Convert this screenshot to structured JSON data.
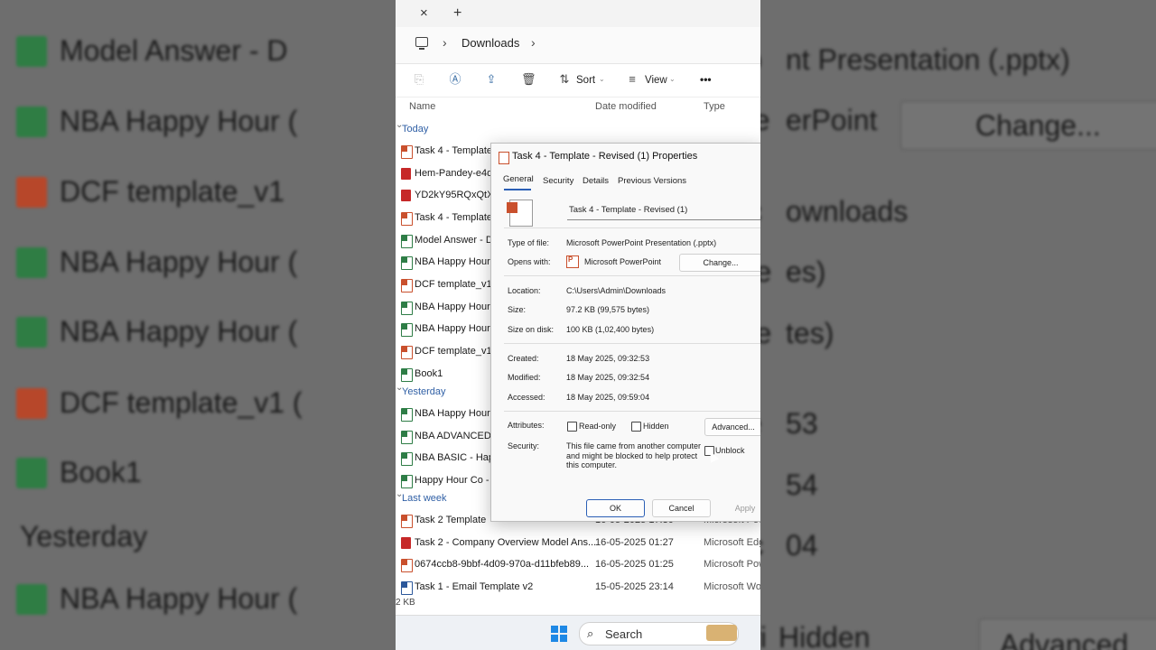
{
  "window": {
    "tab_close": "×",
    "tab_add": "+",
    "breadcrumb": "Downloads",
    "toolbar": {
      "sort_label": "Sort",
      "view_label": "View",
      "more_label": "•••"
    },
    "columns": {
      "name": "Name",
      "date": "Date modified",
      "type": "Type"
    },
    "groups": {
      "today": "Today",
      "yesterday": "Yesterday",
      "last_week": "Last week"
    },
    "files_today": [
      {
        "name": "Task 4 - Template - Revised (1)",
        "icon": "pp"
      },
      {
        "name": "Hem-Pandey-e4de",
        "icon": "pdf"
      },
      {
        "name": "YD2kY95RQxQtXx",
        "icon": "pdf"
      },
      {
        "name": "Task 4 - Template",
        "icon": "pp"
      },
      {
        "name": "Model Answer - D",
        "icon": "xl"
      },
      {
        "name": "NBA Happy Hour",
        "icon": "xl"
      },
      {
        "name": "DCF template_v1",
        "icon": "pp"
      },
      {
        "name": "NBA Happy Hour",
        "icon": "xl"
      },
      {
        "name": "NBA Happy Hour",
        "icon": "xl"
      },
      {
        "name": "DCF template_v1 (",
        "icon": "pp"
      },
      {
        "name": "Book1",
        "icon": "xl"
      }
    ],
    "files_yesterday": [
      {
        "name": "NBA Happy Hour",
        "icon": "xl"
      },
      {
        "name": "NBA ADVANCED -",
        "icon": "xl"
      },
      {
        "name": "NBA BASIC - Happ",
        "icon": "xl"
      },
      {
        "name": "Happy Hour Co - F",
        "icon": "xl"
      }
    ],
    "files_last_week": [
      {
        "name": "Task 2 Template",
        "date": "16-05-2025 17:30",
        "type": "Microsoft Pow",
        "icon": "pp"
      },
      {
        "name": "Task 2 - Company Overview Model Ans...",
        "date": "16-05-2025 01:27",
        "type": "Microsoft Edg",
        "icon": "pdf"
      },
      {
        "name": "0674ccb8-9bbf-4d09-970a-d11bfeb89...",
        "date": "16-05-2025 01:25",
        "type": "Microsoft Pow",
        "icon": "pp"
      },
      {
        "name": "Task 1 - Email Template v2",
        "date": "15-05-2025 23:14",
        "type": "Microsoft Wo",
        "icon": "wd"
      }
    ],
    "status": "2 KB",
    "taskbar": {
      "search_label": "Search"
    }
  },
  "dialog": {
    "title": "Task 4 - Template - Revised (1) Properties",
    "tabs": [
      "General",
      "Security",
      "Details",
      "Previous Versions"
    ],
    "file_name": "Task 4 - Template - Revised (1)",
    "type_label": "Type of file:",
    "type_value": "Microsoft PowerPoint Presentation (.pptx)",
    "opens_label": "Opens with:",
    "opens_value": "Microsoft PowerPoint",
    "change_button": "Change...",
    "location_label": "Location:",
    "location_value": "C:\\Users\\Admin\\Downloads",
    "size_label": "Size:",
    "size_value": "97.2 KB (99,575 bytes)",
    "disk_label": "Size on disk:",
    "disk_value": "100 KB (1,02,400 bytes)",
    "created_label": "Created:",
    "created_value": "18 May 2025, 09:32:53",
    "modified_label": "Modified:",
    "modified_value": "18 May 2025, 09:32:54",
    "accessed_label": "Accessed:",
    "accessed_value": "18 May 2025, 09:59:04",
    "attributes_label": "Attributes:",
    "readonly_label": "Read-only",
    "hidden_label": "Hidden",
    "advanced_button": "Advanced...",
    "security_label": "Security:",
    "security_text_1": "This file came from another computer",
    "security_text_2": "and might be blocked to help protect",
    "security_text_3": "this computer.",
    "unblock_label": "Unblock",
    "ok_button": "OK",
    "cancel_button": "Cancel",
    "apply_button": "Apply"
  },
  "background": {
    "left_rows": [
      "Model Answer - D",
      "NBA Happy Hour (",
      "DCF template_v1",
      "NBA Happy Hour (",
      "NBA Happy Hour (",
      "DCF template_v1 (",
      "Book1",
      "Yesterday",
      "NBA Happy Hour ("
    ],
    "left_icons": [
      "x",
      "x",
      "p",
      "x",
      "x",
      "p",
      "x",
      "",
      "x"
    ],
    "right_rows": [
      "Typ",
      "Ope",
      "Loc",
      "Size",
      "Size",
      "Cre",
      "Mo",
      "Acc",
      "Attri"
    ],
    "right_values": [
      "nt Presentation (.pptx)",
      "erPoint",
      "ownloads",
      "es)",
      "tes)",
      "53",
      "54",
      "04",
      "Hidden"
    ],
    "right_buttons": [
      "Change...",
      "Advanced"
    ]
  }
}
